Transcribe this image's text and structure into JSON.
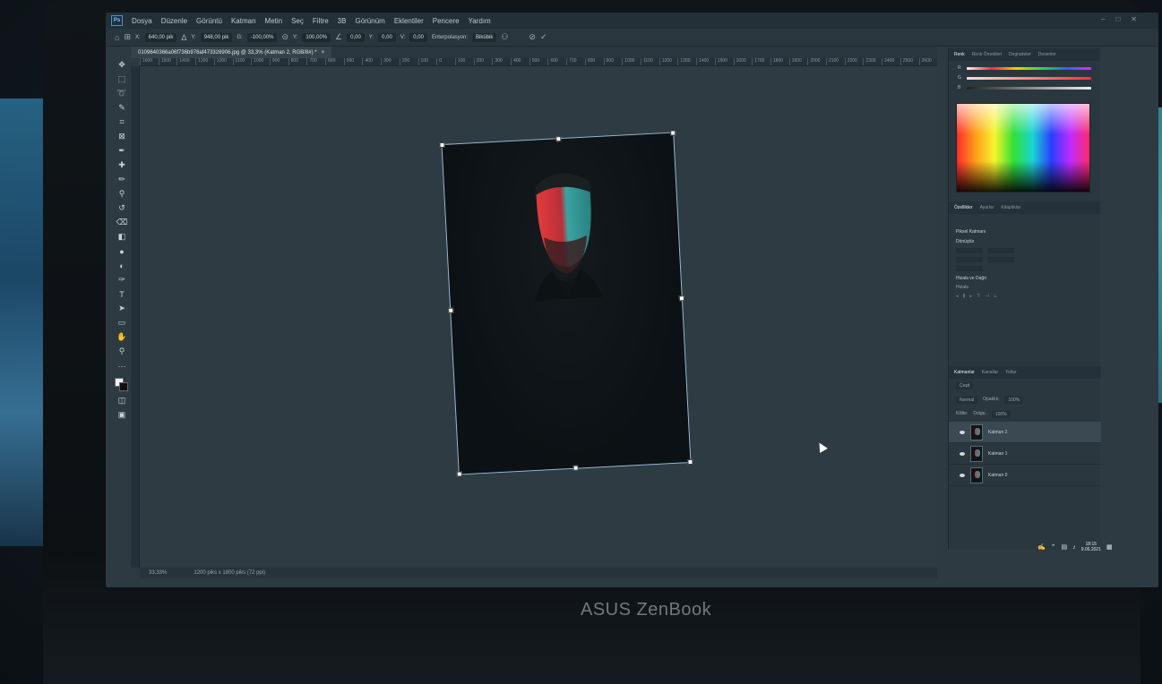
{
  "menu": {
    "logo": "Ps",
    "items": [
      "Dosya",
      "Düzenle",
      "Görüntü",
      "Katman",
      "Metin",
      "Seç",
      "Filtre",
      "3B",
      "Görünüm",
      "Eklentiler",
      "Pencere",
      "Yardım"
    ]
  },
  "options": {
    "x_value": "640,00 pik",
    "y_value": "948,00 pik",
    "w_value": "-100,00%",
    "h_value": "100,00%",
    "angle": "0,00",
    "h_skew": "0,00",
    "v_skew": "0,00",
    "interp_label": "Enterpolasyon:",
    "interp_value": "Bikübik"
  },
  "document": {
    "tab_title": "0109640366a06f736b976af473326906.jpg @ 33,3% (Katman 2, RGB/8#) *"
  },
  "ruler": {
    "ticks": [
      "1600",
      "1500",
      "1400",
      "1300",
      "1200",
      "1100",
      "1000",
      "900",
      "800",
      "700",
      "600",
      "500",
      "400",
      "300",
      "200",
      "100",
      "0",
      "100",
      "200",
      "300",
      "400",
      "500",
      "600",
      "700",
      "800",
      "900",
      "1000",
      "1100",
      "1200",
      "1300",
      "1400",
      "1500",
      "1600",
      "1700",
      "1800",
      "1900",
      "2000",
      "2100",
      "2200",
      "2300",
      "2400",
      "2500",
      "2600"
    ]
  },
  "status": {
    "zoom": "33,33%",
    "doc_info": "1200 piks x 1800 piks (72 ppi)"
  },
  "panels": {
    "color_tabs": [
      "Renk",
      "Renk Örnekleri",
      "Degradeler",
      "Desenler"
    ],
    "props_tabs": [
      "Özellikler",
      "Ayarlar",
      "Kitaplıklar"
    ],
    "props_layer_type": "Piksel Katmanı",
    "props_transform": "Dönüştür",
    "props_align": "Hizala ve Dağıt",
    "props_align_sub": "Hizala",
    "layer_tabs": [
      "Katmanlar",
      "Kanallar",
      "Yollar"
    ],
    "layer_search": "Çeşit",
    "blend_mode": "Normal",
    "opacity_label": "Opaklık:",
    "opacity_value": "100%",
    "fill_label": "Dolgu:",
    "fill_value": "100%",
    "lock_label": "Kilitle:",
    "layers": [
      {
        "name": "Katman 2"
      },
      {
        "name": "Katman 1"
      },
      {
        "name": "Katman 0"
      }
    ]
  },
  "taskbar": {
    "time": "18:15",
    "date": "9.05.2021"
  },
  "brand": "ASUS ZenBook"
}
